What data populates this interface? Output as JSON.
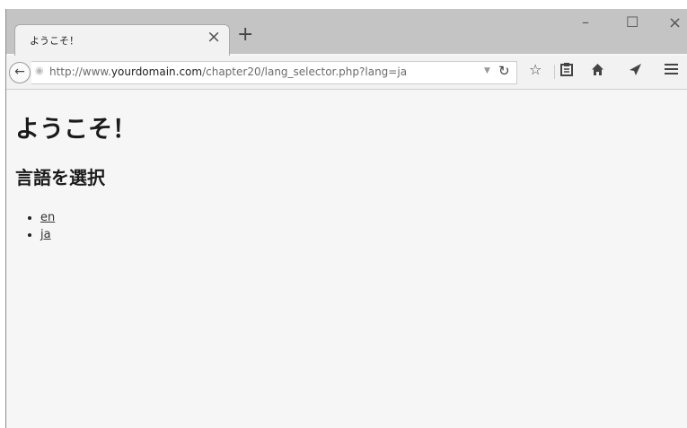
{
  "browser": {
    "tab_title": "ようこそ！",
    "tab_close": "×",
    "new_tab": "+",
    "controls": {
      "minimize": "–",
      "maximize": "☐",
      "close": "×"
    },
    "url": {
      "prefix": "http://www.",
      "domain": "yourdomain.com",
      "path": "/chapter20/lang_selector.php?lang=ja"
    },
    "icons": [
      "back-arrow-icon",
      "globe-icon",
      "dropdown-arrow-icon",
      "reload-icon",
      "star-icon",
      "reading-list-icon",
      "home-icon",
      "send-icon",
      "menu-icon"
    ]
  },
  "page": {
    "heading": "ようこそ！",
    "subheading": "言語を選択",
    "languages": [
      "en",
      "ja"
    ]
  }
}
